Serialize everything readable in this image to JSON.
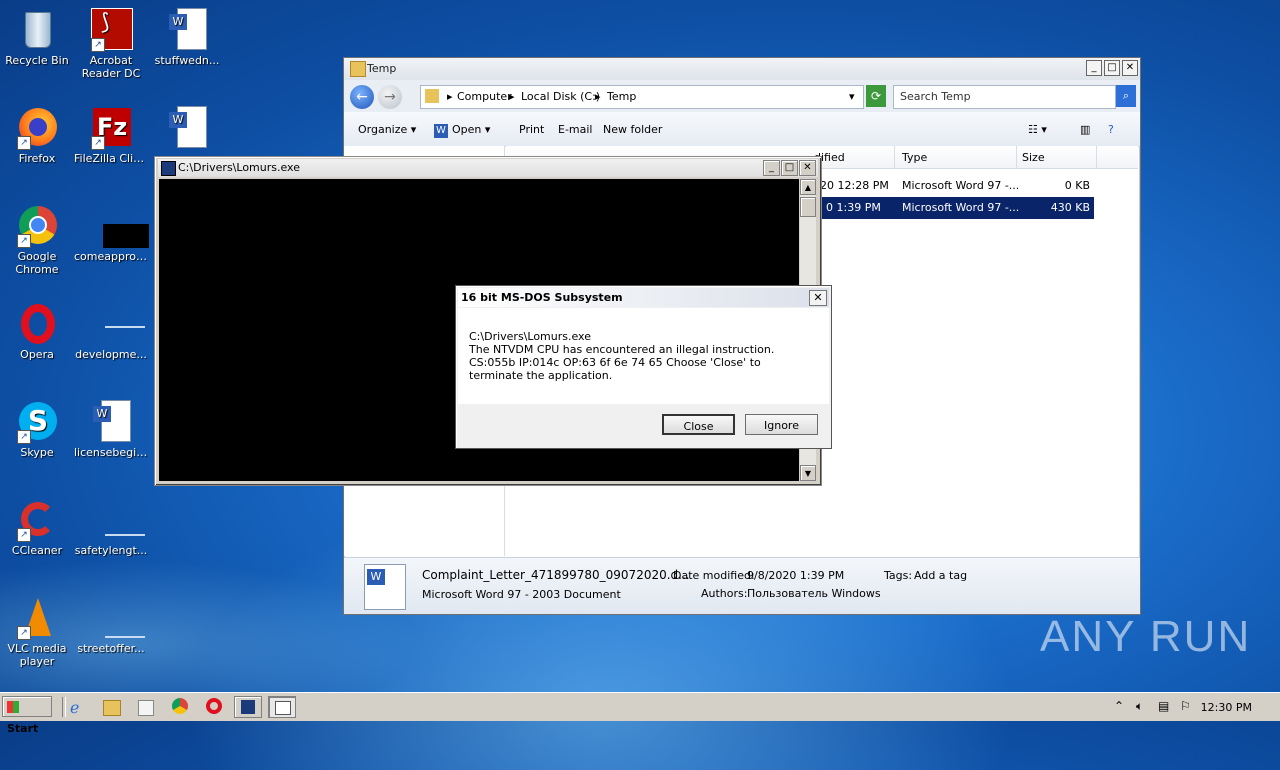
{
  "desktop": {
    "icons": [
      {
        "label": "Recycle Bin"
      },
      {
        "label": "Acrobat Reader DC"
      },
      {
        "label": "stuffwedn..."
      },
      {
        "label": "Firefox"
      },
      {
        "label": "FileZilla Client"
      },
      {
        "label": "Google Chrome"
      },
      {
        "label": "comeapprov..."
      },
      {
        "label": "Opera"
      },
      {
        "label": "developme..."
      },
      {
        "label": "Skype"
      },
      {
        "label": "licensebegin..."
      },
      {
        "label": "CCleaner"
      },
      {
        "label": "safetylengt..."
      },
      {
        "label": "VLC media player"
      },
      {
        "label": "streetoffer..."
      }
    ],
    "watermark": "ANY RUN"
  },
  "explorer": {
    "title": "Temp",
    "breadcrumb": [
      "Computer",
      "Local Disk (C:)",
      "Temp"
    ],
    "search_placeholder": "Search Temp",
    "toolbar": {
      "organize": "Organize",
      "open": "Open",
      "print": "Print",
      "email": "E-mail",
      "new_folder": "New folder"
    },
    "columns": {
      "date_fragment": "dified",
      "type": "Type",
      "size": "Size"
    },
    "files": [
      {
        "date_fragment": "20 12:28 PM",
        "type": "Microsoft Word 97 -...",
        "size": "0 KB"
      },
      {
        "date_fragment": "0 1:39 PM",
        "type": "Microsoft Word 97 -...",
        "size": "430 KB"
      }
    ],
    "details": {
      "filename": "Complaint_Letter_471899780_09072020.d...",
      "doc_type": "Microsoft Word 97 - 2003 Document",
      "date_label": "Date modified:",
      "date_value": "9/8/2020 1:39 PM",
      "tags_label": "Tags:",
      "tags_value": "Add a tag",
      "authors_label": "Authors:",
      "authors_value": "Пользователь Windows"
    }
  },
  "console": {
    "title": "C:\\Drivers\\Lomurs.exe"
  },
  "dialog": {
    "title": "16 bit MS-DOS Subsystem",
    "line1": "C:\\Drivers\\Lomurs.exe",
    "line2": "The NTVDM CPU has encountered an illegal instruction.",
    "line3": "CS:055b IP:014c OP:63 6f 6e 74 65 Choose 'Close' to terminate the application.",
    "close_btn": "Close",
    "ignore_btn": "Ignore"
  },
  "taskbar": {
    "start_label": "Start",
    "clock": "12:30 PM"
  }
}
